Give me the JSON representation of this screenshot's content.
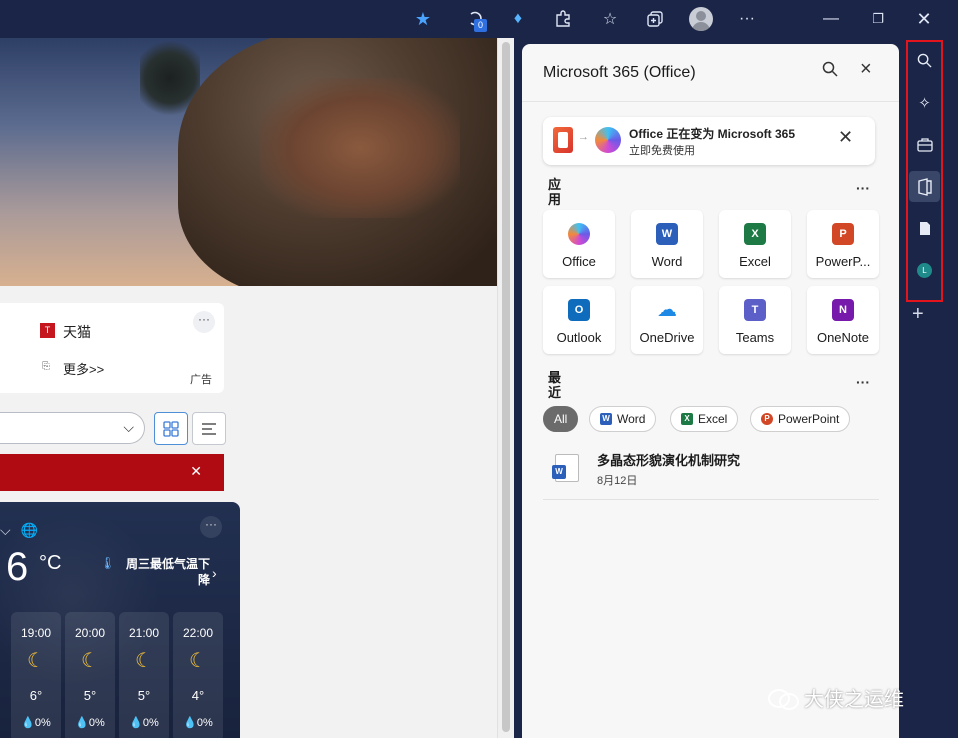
{
  "toolbar": {
    "badge": "0",
    "icons": [
      "favorite-star-icon",
      "extensions-counter-icon",
      "diamond-icon",
      "puzzle-icon",
      "favorites-icon",
      "collections-icon",
      "profile-avatar",
      "more-icon",
      "minimize-icon",
      "restore-icon",
      "close-icon"
    ]
  },
  "web": {
    "ad": {
      "item1": "天猫",
      "item2": "更多>>",
      "label": "广告",
      "more": "···"
    },
    "alert_close": "✕",
    "weather": {
      "temp": "6",
      "unit": "°C",
      "alert": "周三最低气温下降",
      "hours": [
        {
          "time": "19:00",
          "temp": "6°",
          "precip": "0%"
        },
        {
          "time": "20:00",
          "temp": "5°",
          "precip": "0%"
        },
        {
          "time": "21:00",
          "temp": "5°",
          "precip": "0%"
        },
        {
          "time": "22:00",
          "temp": "4°",
          "precip": "0%"
        }
      ]
    }
  },
  "panel": {
    "title": "Microsoft 365 (Office)",
    "banner": {
      "title": "Office 正在变为 Microsoft 365",
      "subtitle": "立即免费使用"
    },
    "apps_label": "应用",
    "more": "···",
    "apps": [
      {
        "name": "Office",
        "color": "#7b5be8"
      },
      {
        "name": "Word",
        "color": "#2b5fba"
      },
      {
        "name": "Excel",
        "color": "#1e7a45"
      },
      {
        "name": "PowerP...",
        "color": "#d24726"
      },
      {
        "name": "Outlook",
        "color": "#0f6cbd"
      },
      {
        "name": "OneDrive",
        "color": "#1e88e5"
      },
      {
        "name": "Teams",
        "color": "#5b5fc7"
      },
      {
        "name": "OneNote",
        "color": "#7719aa"
      }
    ],
    "recent_label": "最近",
    "filters": [
      "All",
      "Word",
      "Excel",
      "PowerPoint"
    ],
    "recent": [
      {
        "name": "多晶态形貌演化机制研究",
        "date": "8月12日"
      }
    ]
  },
  "sidebar": {
    "items": [
      "search-icon",
      "copilot-sparkle-icon",
      "tools-briefcase-icon",
      "office-icon",
      "document-icon",
      "user-avatar-icon"
    ],
    "avatar_letter": "L"
  },
  "watermark": "大侠之运维"
}
